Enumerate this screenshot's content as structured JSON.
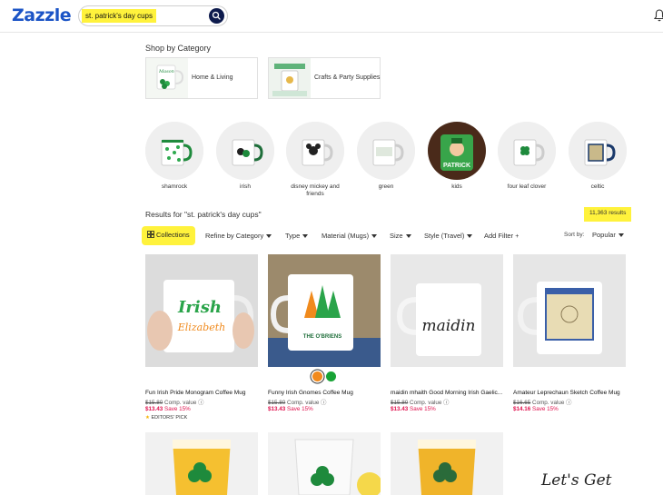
{
  "header": {
    "logo": "Zazzle",
    "search": {
      "value": "st. patrick's day cups"
    }
  },
  "shop_by_category": {
    "title": "Shop by Category",
    "items": [
      {
        "label": "Home & Living"
      },
      {
        "label": "Crafts & Party Supplies"
      }
    ]
  },
  "round_categories": [
    {
      "label": "shamrock"
    },
    {
      "label": "irish"
    },
    {
      "label": "disney mickey and friends"
    },
    {
      "label": "green"
    },
    {
      "label": "kids"
    },
    {
      "label": "four leaf clover"
    },
    {
      "label": "celtic"
    }
  ],
  "results": {
    "heading": "Results for \"st. patrick's day cups\"",
    "count": "11,363 results"
  },
  "filters": {
    "collections": "Collections",
    "items": [
      "Refine by Category",
      "Type",
      "Material (Mugs)",
      "Size",
      "Style (Travel)"
    ],
    "add_filter": "Add Filter",
    "sort_label": "Sort by:",
    "sort_value": "Popular"
  },
  "products": [
    {
      "title": "Fun Irish Pride Monogram Coffee Mug",
      "old_price": "$15.80",
      "comp": "Comp. value",
      "price": "$13.43",
      "save": "Save 15%",
      "badge": "EDITORS' PICK"
    },
    {
      "title": "Funny Irish Gnomes Coffee Mug",
      "old_price": "$15.80",
      "comp": "Comp. value",
      "price": "$13.43",
      "save": "Save 15%",
      "image_text": "THE O'BRIENS"
    },
    {
      "title": "maidin mhaith Good Morning Irish Gaelic...",
      "old_price": "$15.80",
      "comp": "Comp. value",
      "price": "$13.43",
      "save": "Save 15%",
      "image_text": "maidin"
    },
    {
      "title": "Amateur Leprechaun Sketch Coffee Mug",
      "old_price": "$16.65",
      "comp": "Comp. value",
      "price": "$14.16",
      "save": "Save 15%"
    }
  ],
  "mug1_text": {
    "line1": "Irish",
    "line2": "Elizabeth"
  },
  "kids_mug_text": "PATRICK",
  "swatch_colors": [
    "#f28a1d",
    "#18a335"
  ],
  "script_text": "Let's Get",
  "colors": {
    "accent": "#1b54c6",
    "highlight": "#fff23c",
    "price": "#e0104d"
  }
}
